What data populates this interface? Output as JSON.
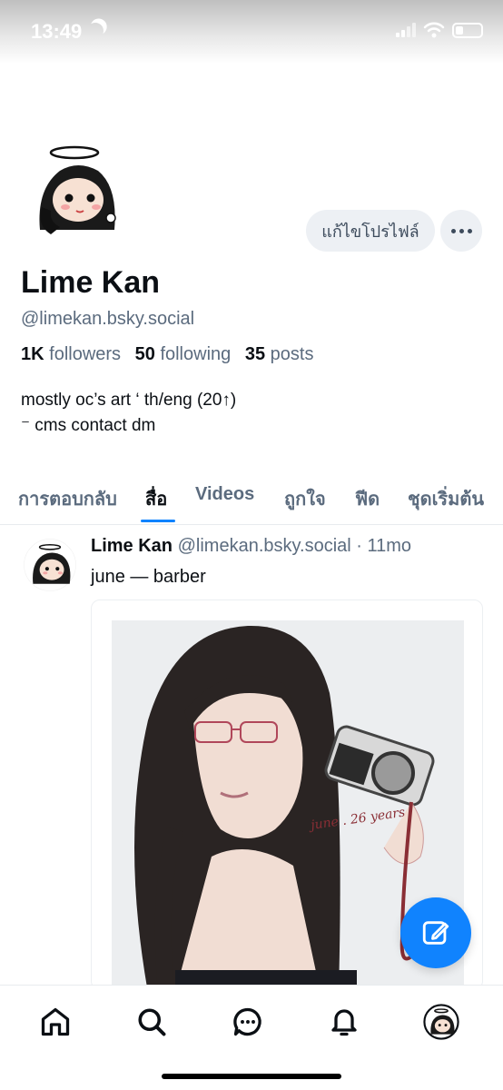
{
  "status_bar": {
    "time": "13:49"
  },
  "profile": {
    "display_name": "Lime Kan",
    "handle": "@limekan.bsky.social",
    "followers_count": "1K",
    "followers_label": "followers",
    "following_count": "50",
    "following_label": "following",
    "posts_count": "35",
    "posts_label": "posts",
    "bio": "mostly oc’s art ‘ th/eng (20↑)\n⁻ cms contact dm",
    "edit_label": "แก้ไขโปรไฟล์"
  },
  "tabs": [
    {
      "label": "การตอบกลับ"
    },
    {
      "label": "สื่อ"
    },
    {
      "label": "Videos"
    },
    {
      "label": "ถูกใจ"
    },
    {
      "label": "ฟีด"
    },
    {
      "label": "ชุดเริ่มต้น"
    }
  ],
  "post": {
    "author": "Lime Kan",
    "handle": "@limekan.bsky.social",
    "separator": "·",
    "time": "11mo",
    "text": "june — barber",
    "image_signature": "june . 26 years"
  },
  "colors": {
    "accent": "#1083fe",
    "muted_text": "#5b6b7e",
    "button_bg": "#edf0f4"
  },
  "nav": [
    {
      "icon": "home-icon"
    },
    {
      "icon": "search-icon"
    },
    {
      "icon": "chat-icon"
    },
    {
      "icon": "bell-icon"
    },
    {
      "icon": "profile-avatar-icon"
    }
  ]
}
